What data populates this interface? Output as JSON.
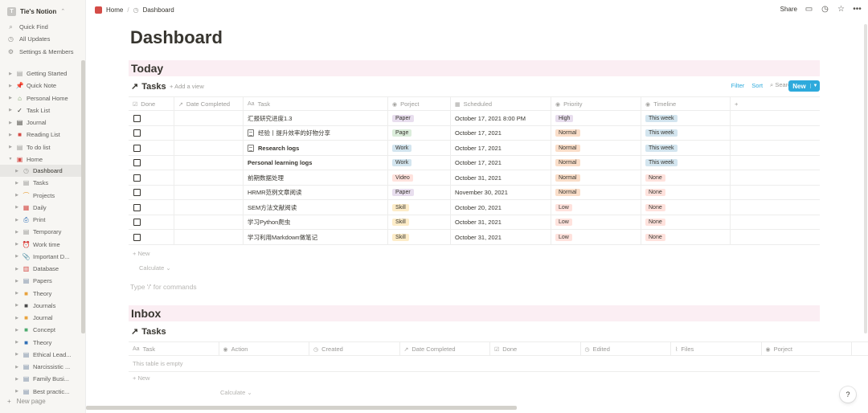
{
  "sidebar": {
    "workspace": "Tie's Notion",
    "workspace_initial": "T",
    "top_items": [
      {
        "label": "Quick Find",
        "icon": "search-icon",
        "glyph": "⌕"
      },
      {
        "label": "All Updates",
        "icon": "clock-icon",
        "glyph": "◷"
      },
      {
        "label": "Settings & Members",
        "icon": "gear-icon",
        "glyph": "⚙"
      }
    ],
    "pages": [
      {
        "label": "Getting Started",
        "icon": "page-icon",
        "glyph": "▤",
        "color": "#9b9a97"
      },
      {
        "label": "Quick Note",
        "icon": "pin-icon",
        "glyph": "📌",
        "color": "#d44c47"
      },
      {
        "label": "Personal Home",
        "icon": "home-icon",
        "glyph": "⌂",
        "color": "#6a9955"
      },
      {
        "label": "Task List",
        "icon": "checkmark-icon",
        "glyph": "✓",
        "color": "#37352f"
      },
      {
        "label": "Journal",
        "icon": "notebook-icon",
        "glyph": "▤",
        "color": "#37352f"
      },
      {
        "label": "Reading List",
        "icon": "book-icon",
        "glyph": "■",
        "color": "#d44c47"
      },
      {
        "label": "To do list",
        "icon": "page-icon",
        "glyph": "▤",
        "color": "#9b9a97"
      },
      {
        "label": "Home",
        "icon": "home-icon",
        "glyph": "▣",
        "color": "#d44c47",
        "expanded": true
      }
    ],
    "children": [
      {
        "label": "Dashboard",
        "icon": "clock-icon",
        "glyph": "◷",
        "color": "#9b9a97",
        "active": true
      },
      {
        "label": "Tasks",
        "icon": "page-icon",
        "glyph": "▤",
        "color": "#9b9a97"
      },
      {
        "label": "Projects",
        "icon": "rainbow-icon",
        "glyph": "⌒",
        "color": "#e8a33d"
      },
      {
        "label": "Daily",
        "icon": "calendar-icon",
        "glyph": "▦",
        "color": "#d44c47"
      },
      {
        "label": "Print",
        "icon": "printer-icon",
        "glyph": "⎙",
        "color": "#2f6fb5"
      },
      {
        "label": "Temporary",
        "icon": "page-icon",
        "glyph": "▤",
        "color": "#9b9a97"
      },
      {
        "label": "Work time",
        "icon": "alarm-clock-icon",
        "glyph": "⏰",
        "color": "#d44c47"
      },
      {
        "label": "Important D...",
        "icon": "pin-icon",
        "glyph": "📎",
        "color": "#9b9a97"
      },
      {
        "label": "Database",
        "icon": "book-icon",
        "glyph": "▥",
        "color": "#d44c47"
      },
      {
        "label": "Papers",
        "icon": "document-icon",
        "glyph": "▤",
        "color": "#7b8ea6"
      },
      {
        "label": "Theory",
        "icon": "book-icon",
        "glyph": "■",
        "color": "#e8a33d"
      },
      {
        "label": "Journals",
        "icon": "book-icon",
        "glyph": "■",
        "color": "#4a4a4a"
      },
      {
        "label": "Journal",
        "icon": "book-icon",
        "glyph": "■",
        "color": "#e8a33d"
      },
      {
        "label": "Concept",
        "icon": "book-icon",
        "glyph": "■",
        "color": "#4dab6f"
      },
      {
        "label": "Theory",
        "icon": "book-icon",
        "glyph": "■",
        "color": "#2f6fb5"
      },
      {
        "label": "Ethical Lead...",
        "icon": "document-icon",
        "glyph": "▤",
        "color": "#7b8ea6"
      },
      {
        "label": "Narcissistic ...",
        "icon": "document-icon",
        "glyph": "▤",
        "color": "#7b8ea6"
      },
      {
        "label": "Family Busi...",
        "icon": "document-icon",
        "glyph": "▤",
        "color": "#7b8ea6"
      },
      {
        "label": "Best practic...",
        "icon": "document-icon",
        "glyph": "▤",
        "color": "#7b8ea6"
      }
    ],
    "new_page": "New page"
  },
  "topbar": {
    "breadcrumb_home": "Home",
    "breadcrumb_sep": "/",
    "breadcrumb_current": "Dashboard",
    "share": "Share"
  },
  "page": {
    "title": "Dashboard",
    "command_placeholder": "Type '/' for commands"
  },
  "today": {
    "heading": "Today",
    "view_title": "Tasks",
    "add_view": "Add a view",
    "filter": "Filter",
    "sort": "Sort",
    "search": "Search",
    "new_button": "New",
    "columns": [
      "Done",
      "Date Completed",
      "Task",
      "Porject",
      "Scheduled",
      "Priority",
      "Timeline"
    ],
    "rows": [
      {
        "task": "汇报研究进度1.3",
        "doc": false,
        "bold": false,
        "project": "Paper",
        "scheduled": "October 17, 2021 8:00 PM",
        "priority": "High",
        "timeline": "This week"
      },
      {
        "task": "经验丨提升效率的好物分享",
        "doc": true,
        "bold": false,
        "project": "Page",
        "scheduled": "October 17, 2021",
        "priority": "Normal",
        "timeline": "This week"
      },
      {
        "task": "Research logs",
        "doc": true,
        "bold": true,
        "project": "Work",
        "scheduled": "October 17, 2021",
        "priority": "Normal",
        "timeline": "This week"
      },
      {
        "task": "Personal learning logs",
        "doc": false,
        "bold": true,
        "project": "Work",
        "scheduled": "October 17, 2021",
        "priority": "Normal",
        "timeline": "This week"
      },
      {
        "task": "前期数据处理",
        "doc": false,
        "bold": false,
        "project": "Video",
        "scheduled": "October 31, 2021",
        "priority": "Normal",
        "timeline": "None"
      },
      {
        "task": "HRMR范例文章阅读",
        "doc": false,
        "bold": false,
        "project": "Paper",
        "scheduled": "November 30, 2021",
        "priority": "Normal",
        "timeline": "None"
      },
      {
        "task": "SEM方法文献阅读",
        "doc": false,
        "bold": false,
        "project": "Skill",
        "scheduled": "October 20, 2021",
        "priority": "Low",
        "timeline": "None"
      },
      {
        "task": "学习Python爬虫",
        "doc": false,
        "bold": false,
        "project": "Skill",
        "scheduled": "October 31, 2021",
        "priority": "Low",
        "timeline": "None"
      },
      {
        "task": "学习利用Markdown做笔记",
        "doc": false,
        "bold": false,
        "project": "Skill",
        "scheduled": "October 31, 2021",
        "priority": "Low",
        "timeline": "None"
      }
    ],
    "new_row": "+ New",
    "calculate": "Calculate ⌄"
  },
  "inbox": {
    "heading": "Inbox",
    "view_title": "Tasks",
    "columns": [
      "Task",
      "Action",
      "Created",
      "Date Completed",
      "Done",
      "Edited",
      "Files",
      "Porject"
    ],
    "empty": "This table is empty",
    "new_row": "+ New",
    "calculate": "Calculate ⌄"
  },
  "help": "?",
  "tag_colors": {
    "Paper": "#e8deee",
    "Page": "#dbeddb",
    "Work": "#d3e5ef",
    "Video": "#ffe2dd",
    "Skill": "#fdecc8",
    "High": "#e8deee",
    "Normal": "#fadec9",
    "Low": "#ffe2dd",
    "This week": "#d3e5ef",
    "None": "#ffe2dd"
  }
}
